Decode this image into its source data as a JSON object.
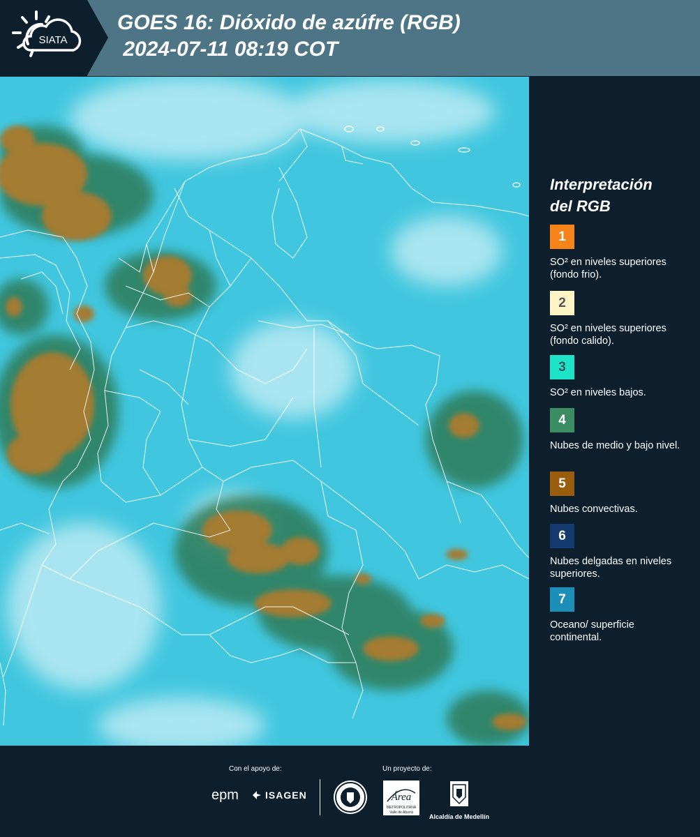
{
  "header": {
    "title": "GOES 16: Dióxido de azúfre (RGB)\n 2024-07-11 08:19 COT",
    "logo_text": "SIATA"
  },
  "legend": {
    "title": "Interpretación\ndel RGB",
    "items": [
      {
        "number": "1",
        "label": "SO² en niveles superiores (fondo frio).",
        "color": "#f68419",
        "text_color": "#ffffff"
      },
      {
        "number": "2",
        "label": "SO² en niveles superiores (fondo calido).",
        "color": "#fdf6c4",
        "text_color": "#555555"
      },
      {
        "number": "3",
        "label": "SO² en niveles bajos.",
        "color": "#1fe3c8",
        "text_color": "#3a5a5a"
      },
      {
        "number": "4",
        "label": "Nubes de medio y bajo nivel.",
        "color": "#3b8c63",
        "text_color": "#ffffff"
      },
      {
        "number": "5",
        "label": "Nubes convectivas.",
        "color": "#9a5d0e",
        "text_color": "#ffffff"
      },
      {
        "number": "6",
        "label": "Nubes delgadas en niveles superiores.",
        "color": "#143b6f",
        "text_color": "#ffffff"
      },
      {
        "number": "7",
        "label": "Oceano/ superficie continental.",
        "color": "#1b8fb7",
        "text_color": "#ffffff"
      }
    ]
  },
  "footer": {
    "support_label": "Con el apoyo de:",
    "project_label": "Un proyecto de:",
    "sponsors": [
      "epm",
      "ISAGEN"
    ],
    "partners": {
      "area_name": "Área",
      "area_sub1": "METROPOLITANA",
      "area_sub2": "Valle de Aburrá",
      "alcaldia": "Alcaldía de Medellín"
    }
  },
  "colors": {
    "background": "#0d1f2d",
    "header": "#4d7585",
    "map_base": "#3fc4dc",
    "convective": "#a57a35",
    "mid_low_cloud": "#2f7a5a",
    "thin_high_cloud": "#c8eef4",
    "borders": "#ffffff"
  }
}
